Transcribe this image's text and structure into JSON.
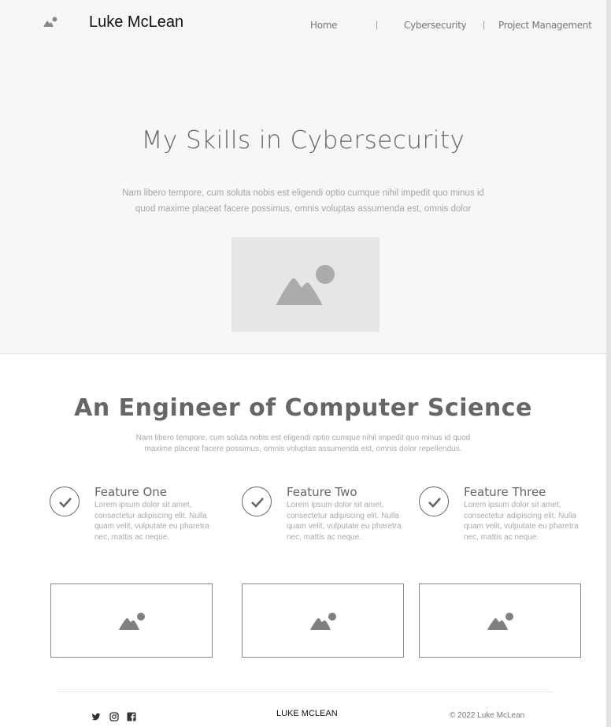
{
  "header": {
    "site_name": "Luke McLean",
    "logo_icon": "image-placeholder-icon",
    "nav": [
      "Home",
      "Cybersecurity",
      "Project Management"
    ],
    "separator": "|"
  },
  "hero": {
    "title": "My Skills in Cybersecurity",
    "text": "Nam libero tempore, cum soluta nobis est eligendi optio cumque nihil impedit quo minus id quod maxime placeat facere possimus, omnis voluptas assumenda est, omnis dolor",
    "image_icon": "image-placeholder-icon"
  },
  "about": {
    "title": "An Engineer of Computer Science",
    "text": "Nam libero tempore, cum soluta nobis est eligendi optio cumque nihil impedit quo minus id quod maxime placeat facere possimus, omnis voluptas assumenda est, omnis dolor repellendus."
  },
  "features": [
    {
      "title": "Feature One",
      "text": "Lorem ipsum dolor sit amet, consectetur adipiscing elit. Nulla quam velit, vulputate eu pharetra nec, mattis ac neque.",
      "icon": "check-icon"
    },
    {
      "title": "Feature Two",
      "text": "Lorem ipsum dolor sit amet, consectetur adipiscing elit. Nulla quam velit, vulputate eu pharetra nec, mattis ac neque.",
      "icon": "check-icon"
    },
    {
      "title": "Feature Three",
      "text": "Lorem ipsum dolor sit amet, consectetur adipiscing elit. Nulla quam velit, vulputate eu pharetra nec, mattis ac neque.",
      "icon": "check-icon"
    }
  ],
  "footer": {
    "social_icons": [
      "twitter-icon",
      "instagram-icon",
      "facebook-icon"
    ],
    "brand": "LUKE MCLEAN",
    "copyright": "© 2022 Luke McLean"
  },
  "colors": {
    "header_bg": "#f7f7f7",
    "placeholder_bg": "#e6e6e6",
    "icon_gray": "#888888",
    "text_gray": "#666666"
  }
}
